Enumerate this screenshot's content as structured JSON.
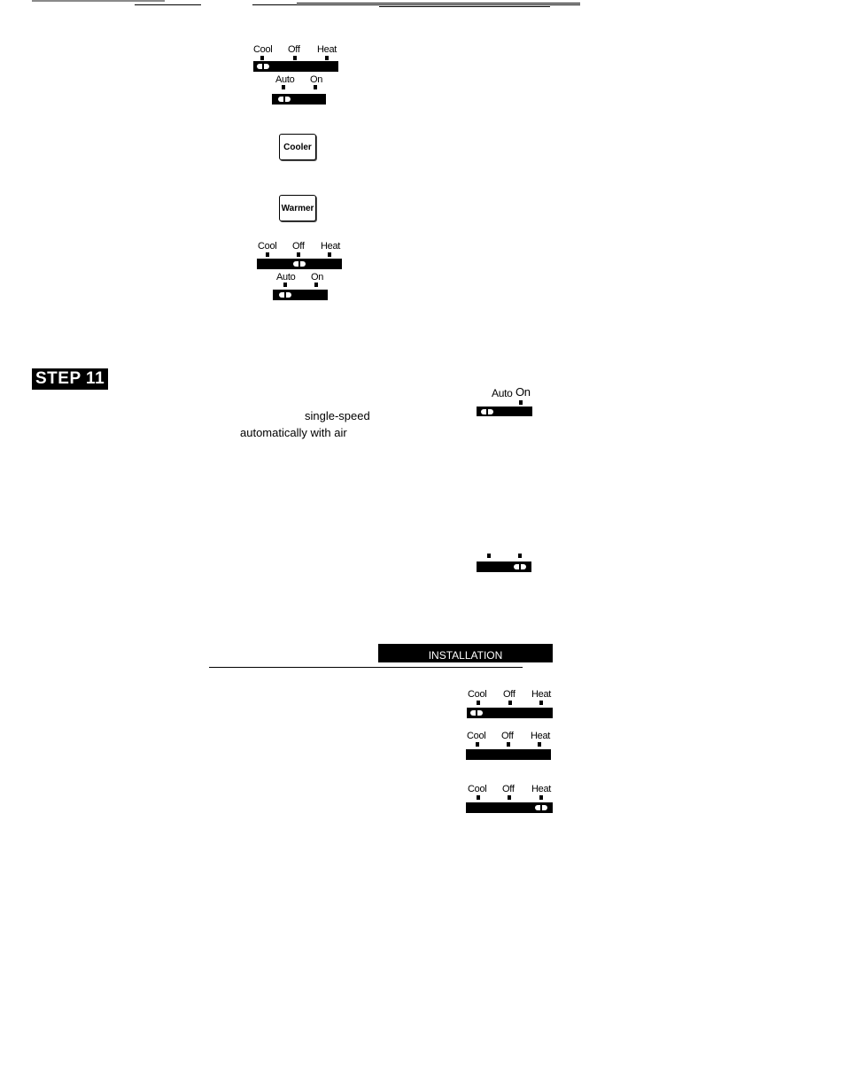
{
  "header": {
    "rules": "top page rules (scan artifacts)"
  },
  "switch_sets": [
    {
      "system_switch": {
        "labels": [
          "Cool",
          "Off",
          "Heat"
        ],
        "position": "Cool"
      },
      "fan_switch": {
        "labels": [
          "Auto",
          "On"
        ],
        "position": "Auto"
      }
    },
    {
      "system_switch": {
        "labels": [
          "Cool",
          "Off",
          "Heat"
        ],
        "position": "Off"
      },
      "fan_switch": {
        "labels": [
          "Auto",
          "On"
        ],
        "position": "Auto"
      }
    }
  ],
  "buttons": {
    "cooler": "Cooler",
    "warmer": "Warmer"
  },
  "step": {
    "label": "STEP 11"
  },
  "step11_text": {
    "line1": "single-speed",
    "line2": "automatically with air"
  },
  "fan_switch_step11": {
    "labels": [
      "Auto",
      "On"
    ],
    "position": "Auto"
  },
  "fan_switch_unlabeled": {
    "position": "On"
  },
  "section_banner": "INSTALLATION",
  "system_switches_right": [
    {
      "labels": [
        "Cool",
        "Off",
        "Heat"
      ],
      "position": "Cool"
    },
    {
      "labels": [
        "Cool",
        "Off",
        "Heat"
      ],
      "position": "none"
    },
    {
      "labels": [
        "Cool",
        "Off",
        "Heat"
      ],
      "position": "Heat"
    }
  ]
}
